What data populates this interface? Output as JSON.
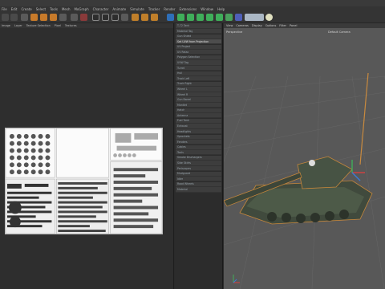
{
  "menubar": [
    "File",
    "Edit",
    "Create",
    "Select",
    "Tools",
    "Mesh",
    "MoGraph",
    "Character",
    "Animate",
    "Simulate",
    "Tracker",
    "Render",
    "Extensions",
    "Window",
    "Help"
  ],
  "texture_panel": {
    "menu": [
      "Image",
      "Layer",
      "Texture Selection",
      "Pixel",
      "Textures"
    ]
  },
  "object_panel": {
    "items": [
      {
        "label": "T-72 Tank",
        "selected": false
      },
      {
        "label": "Material Tag",
        "selected": false
      },
      {
        "label": "Gun Shield",
        "selected": false
      },
      {
        "label": "Set UVW from Projection",
        "selected": true
      },
      {
        "label": "UV Project",
        "selected": false
      },
      {
        "label": "UV Relax",
        "selected": false
      },
      {
        "label": "Polygon Selection",
        "selected": false
      },
      {
        "label": "UVW Tag",
        "selected": false
      },
      {
        "label": "Turret",
        "selected": false
      },
      {
        "label": "Hull",
        "selected": false
      },
      {
        "label": "Track Left",
        "selected": false
      },
      {
        "label": "Track Right",
        "selected": false
      },
      {
        "label": "Wheel L",
        "selected": false
      },
      {
        "label": "Wheel R",
        "selected": false
      },
      {
        "label": "Gun Barrel",
        "selected": false
      },
      {
        "label": "Mantlet",
        "selected": false
      },
      {
        "label": "Hatch",
        "selected": false
      },
      {
        "label": "Antenna",
        "selected": false
      },
      {
        "label": "Fuel Tank",
        "selected": false
      },
      {
        "label": "Exhaust",
        "selected": false
      },
      {
        "label": "Headlights",
        "selected": false
      },
      {
        "label": "Sprockets",
        "selected": false
      },
      {
        "label": "Fenders",
        "selected": false
      },
      {
        "label": "Cables",
        "selected": false
      },
      {
        "label": "Tools",
        "selected": false
      },
      {
        "label": "Smoke Dischargers",
        "selected": false
      },
      {
        "label": "Side Skirts",
        "selected": false
      },
      {
        "label": "Periscopes",
        "selected": false
      },
      {
        "label": "Mudguard",
        "selected": false
      },
      {
        "label": "Idler",
        "selected": false
      },
      {
        "label": "Road Wheels",
        "selected": false
      },
      {
        "label": "Material",
        "selected": false
      }
    ]
  },
  "viewport": {
    "menu": [
      "View",
      "Cameras",
      "Display",
      "Options",
      "Filter",
      "Panel"
    ],
    "label": "Perspective",
    "camera": "Default Camera"
  }
}
